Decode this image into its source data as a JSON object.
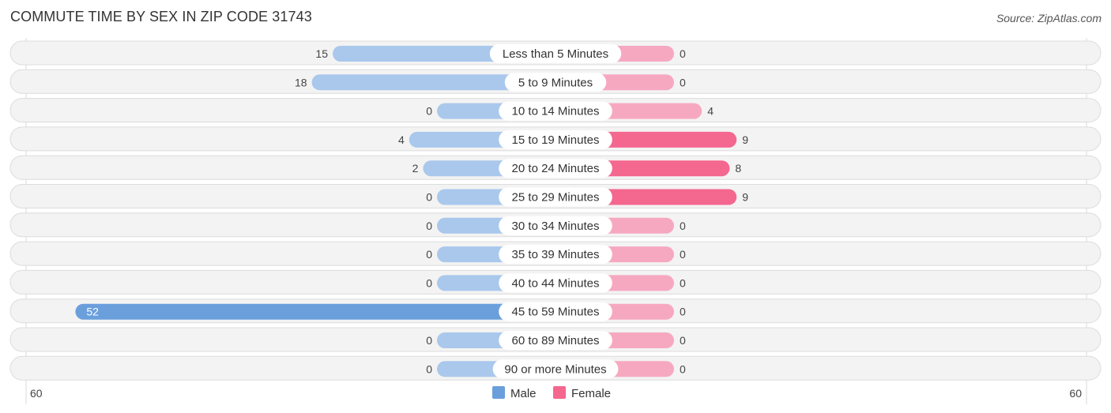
{
  "header": {
    "title": "COMMUTE TIME BY SEX IN ZIP CODE 31743",
    "source": "Source: ZipAtlas.com"
  },
  "chart_data": {
    "type": "bar",
    "orientation": "horizontal-diverging",
    "title": "COMMUTE TIME BY SEX IN ZIP CODE 31743",
    "categories": [
      "Less than 5 Minutes",
      "5 to 9 Minutes",
      "10 to 14 Minutes",
      "15 to 19 Minutes",
      "20 to 24 Minutes",
      "25 to 29 Minutes",
      "30 to 34 Minutes",
      "35 to 39 Minutes",
      "40 to 44 Minutes",
      "45 to 59 Minutes",
      "60 to 89 Minutes",
      "90 or more Minutes"
    ],
    "series": [
      {
        "name": "Male",
        "color": "#6a9fdc",
        "light_color": "#a9c8ec",
        "values": [
          15,
          18,
          0,
          4,
          2,
          0,
          0,
          0,
          0,
          52,
          0,
          0
        ]
      },
      {
        "name": "Female",
        "color": "#f4678f",
        "light_color": "#f7a8c1",
        "values": [
          0,
          0,
          4,
          9,
          8,
          9,
          0,
          0,
          0,
          0,
          0,
          0
        ]
      }
    ],
    "xlim": [
      -60,
      60
    ],
    "tick_labels": {
      "left": "60",
      "right": "60"
    },
    "legend": {
      "position": "bottom-center",
      "entries": [
        "Male",
        "Female"
      ]
    },
    "grid": false
  }
}
